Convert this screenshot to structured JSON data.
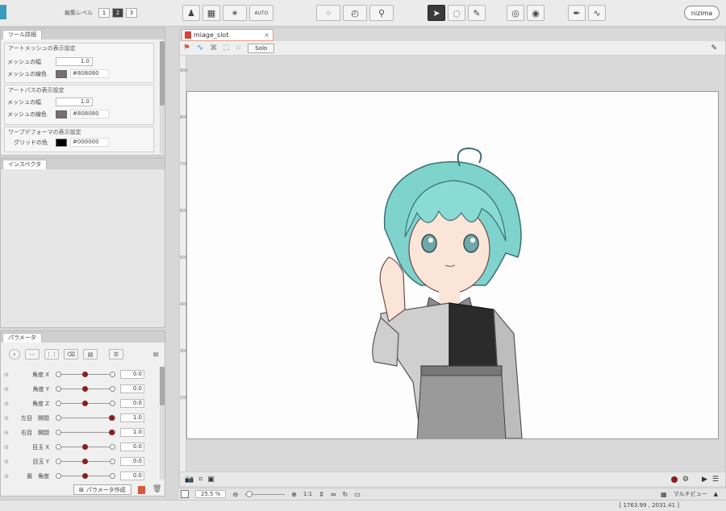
{
  "toolbar": {
    "edit_level_label": "編集レベル",
    "levels": [
      "1",
      "2",
      "3"
    ],
    "selected_level": "2",
    "auto_label": "AUTO",
    "logo_text": "nizima"
  },
  "tool_details": {
    "tab": "ツール詳細",
    "art_mesh_group": "アートメッシュの表示設定",
    "art_mesh_width_label": "メッシュの幅",
    "art_mesh_width": "1.0",
    "art_mesh_color_label": "メッシュの線色",
    "art_mesh_color": "#808080",
    "art_path_group": "アートパスの表示設定",
    "art_path_width_label": "メッシュの幅",
    "art_path_width": "1.0",
    "art_path_color_label": "メッシュの線色",
    "art_path_color": "#808080",
    "warp_group": "ワープデフォーマの表示設定",
    "grid_color_label": "グリッドの色",
    "grid_color": "#000000",
    "swatch_gray": "#7a6c73",
    "swatch_black": "#000000"
  },
  "inspector": {
    "tab": "インスペクタ"
  },
  "parameters": {
    "tab": "パラメータ",
    "create_button": "パラメータ作成",
    "items": [
      {
        "name": "角度 X",
        "value": "0.0",
        "pos": 0.5
      },
      {
        "name": "角度 Y",
        "value": "0.0",
        "pos": 0.5
      },
      {
        "name": "角度 Z",
        "value": "0.0",
        "pos": 0.5
      },
      {
        "name": "左目　開閉",
        "value": "1.0",
        "pos": 1.0
      },
      {
        "name": "右目　開閉",
        "value": "1.0",
        "pos": 1.0
      },
      {
        "name": "目玉 X",
        "value": "0.0",
        "pos": 0.5
      },
      {
        "name": "目玉 Y",
        "value": "0.0",
        "pos": 0.5
      },
      {
        "name": "眉　角度",
        "value": "0.0",
        "pos": 0.5
      }
    ]
  },
  "editor": {
    "doc_tab": "miage_slot",
    "solo_button": "Solo",
    "ruler_numbers": [
      "900",
      "800",
      "700",
      "600",
      "500",
      "400",
      "300",
      "200"
    ],
    "zoom": "25.5 %",
    "ratio": "1:1",
    "multi_view": "マルチビュー"
  },
  "status": {
    "coords": "[ 1763.99 , 2031.41 ]"
  }
}
